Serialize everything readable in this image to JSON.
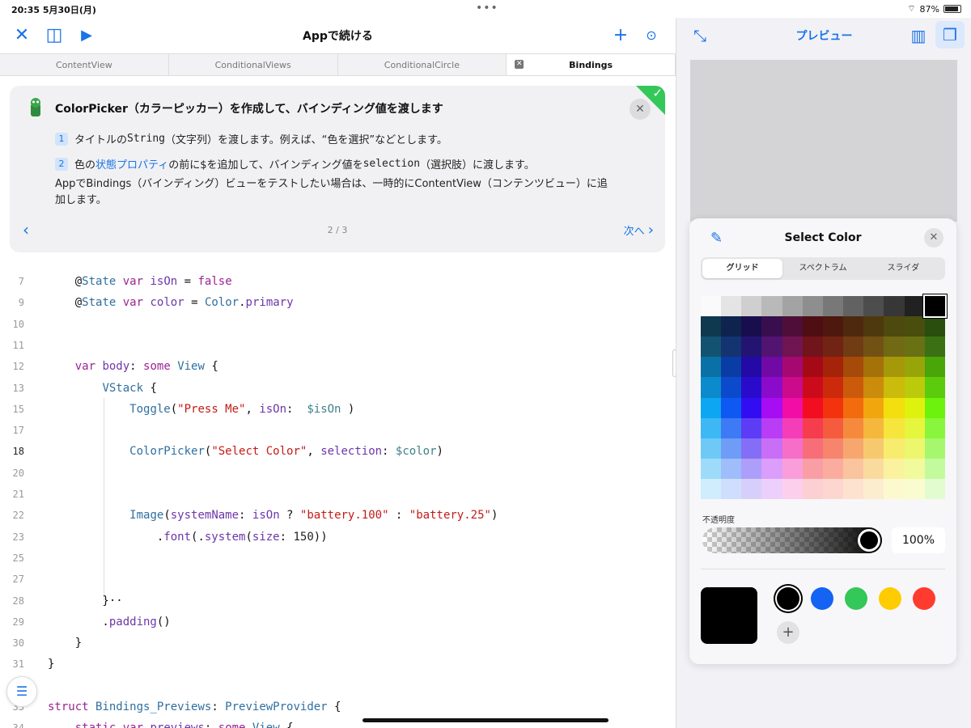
{
  "status": {
    "time": "20:35",
    "date": "5月30日(月)",
    "battery": "87%"
  },
  "app": {
    "title": "Appで続ける",
    "tabs": [
      {
        "label": "ContentView",
        "active": false
      },
      {
        "label": "ConditionalViews",
        "active": false
      },
      {
        "label": "ConditionalCircle",
        "active": false
      },
      {
        "label": "Bindings",
        "active": true
      }
    ]
  },
  "guide": {
    "title": "ColorPicker（カラーピッカー）を作成して、バインディング値を渡します",
    "step1": {
      "num": "1",
      "pre": "タイトルの",
      "code": "String",
      "post": "（文字列）を渡します。例えば、“色を選択”などとします。"
    },
    "step2": {
      "num": "2",
      "pre": "色の",
      "link": "状態プロパティ",
      "mid": "の前に$を追加して、バインディング値を",
      "code": "selection",
      "post": "（選択肢）に渡します。"
    },
    "note": "AppでBindings（バインディング）ビューをテストしたい場合は、一時的にContentView（コンテンツビュー）に追加します。",
    "page": "2 / 3",
    "next": "次へ"
  },
  "code": {
    "lines": [
      {
        "n": "7",
        "t": "    @State var isOn = false"
      },
      {
        "n": "9",
        "t": "    @State var color = Color.primary"
      },
      {
        "n": "10",
        "t": ""
      },
      {
        "n": "11",
        "t": ""
      },
      {
        "n": "12",
        "t": "    var body: some View {"
      },
      {
        "n": "13",
        "t": "        VStack {"
      },
      {
        "n": "15",
        "t": "            Toggle(\"Press Me\", isOn:  $isOn )"
      },
      {
        "n": "17",
        "t": ""
      },
      {
        "n": "18",
        "t": "            ColorPicker(\"Select Color\", selection: $color)"
      },
      {
        "n": "20",
        "t": ""
      },
      {
        "n": "21",
        "t": ""
      },
      {
        "n": "22",
        "t": "            Image(systemName: isOn ? \"battery.100\" : \"battery.25\")"
      },
      {
        "n": "23",
        "t": "                .font(.system(size: 150))"
      },
      {
        "n": "25",
        "t": ""
      },
      {
        "n": "27",
        "t": ""
      },
      {
        "n": "28",
        "t": "        }··"
      },
      {
        "n": "29",
        "t": "        .padding()"
      },
      {
        "n": "30",
        "t": "    }"
      },
      {
        "n": "31",
        "t": "}"
      },
      {
        "n": "32",
        "t": ""
      },
      {
        "n": "33",
        "t": "struct Bindings_Previews: PreviewProvider {"
      },
      {
        "n": "34",
        "t": "    static var previews: some View {"
      }
    ]
  },
  "preview": {
    "title": "プレビュー"
  },
  "picker": {
    "title": "Select Color",
    "segments": [
      "グリッド",
      "スペクトラム",
      "スライダ"
    ],
    "opacity_label": "不透明度",
    "opacity_value": "100%",
    "opacity_fraction": 1.0,
    "favorites": [
      "#000000",
      "#1463f3",
      "#34c759",
      "#ffcc00",
      "#ff3b30"
    ],
    "add_label": "+"
  }
}
